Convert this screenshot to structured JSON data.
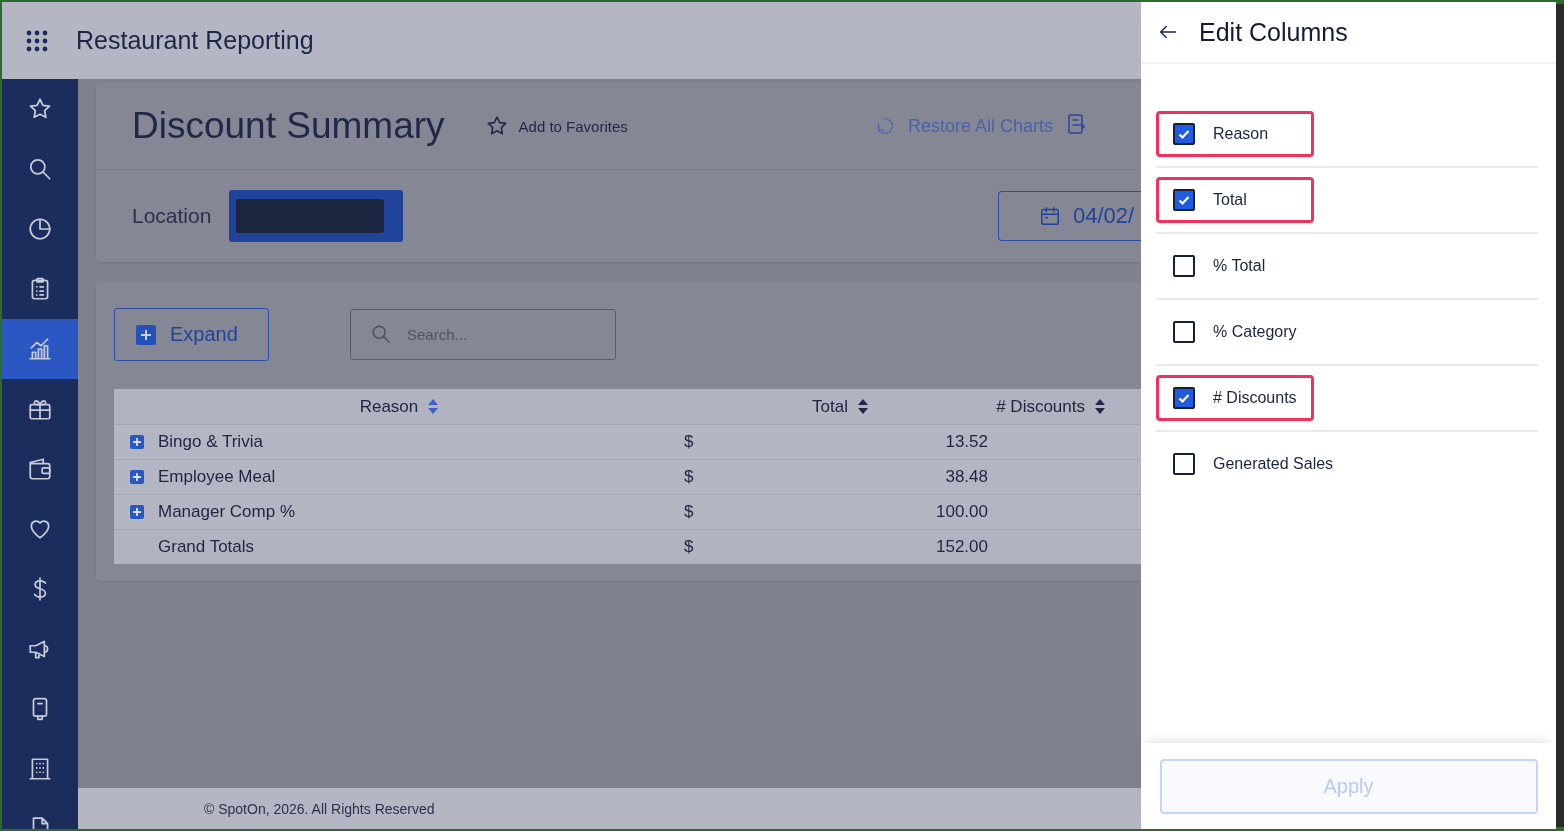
{
  "header": {
    "title": "Restaurant Reporting"
  },
  "sidebar": {
    "items": [
      {
        "selected": false
      },
      {
        "selected": false
      },
      {
        "selected": false
      },
      {
        "selected": false
      },
      {
        "selected": true
      },
      {
        "selected": false
      },
      {
        "selected": false
      },
      {
        "selected": false
      },
      {
        "selected": false
      },
      {
        "selected": false
      },
      {
        "selected": false
      },
      {
        "selected": false
      },
      {
        "selected": false
      }
    ]
  },
  "report": {
    "title": "Discount Summary",
    "favorite_label": "Add to Favorites",
    "restore_label": "Restore All Charts",
    "location_label": "Location",
    "date_value": "04/02/"
  },
  "toolbar": {
    "expand_label": "Expand",
    "search": {
      "placeholder": "Search..."
    }
  },
  "table": {
    "columns": [
      {
        "label": "Reason",
        "sort_active": true
      },
      {
        "label": "Total",
        "sort_active": false
      },
      {
        "label": "# Discounts",
        "sort_active": false
      }
    ],
    "rows": [
      {
        "kind": "item",
        "reason": "Bingo & Trivia",
        "currency": "$",
        "total": "13.52"
      },
      {
        "kind": "item",
        "reason": "Employee Meal",
        "currency": "$",
        "total": "38.48"
      },
      {
        "kind": "item",
        "reason": "Manager Comp %",
        "currency": "$",
        "total": "100.00"
      },
      {
        "kind": "total",
        "reason": "Grand Totals",
        "currency": "$",
        "total": "152.00"
      }
    ]
  },
  "footer": {
    "copyright": "© SpotOn, 2026. All Rights Reserved"
  },
  "panel": {
    "title": "Edit Columns",
    "columns": [
      {
        "label": "Reason",
        "checked": true,
        "highlighted": true
      },
      {
        "label": "Total",
        "checked": true,
        "highlighted": true
      },
      {
        "label": "% Total",
        "checked": false,
        "highlighted": false
      },
      {
        "label": "% Category",
        "checked": false,
        "highlighted": false
      },
      {
        "label": "# Discounts",
        "checked": true,
        "highlighted": true
      },
      {
        "label": "Generated Sales",
        "checked": false,
        "highlighted": false
      }
    ],
    "apply": {
      "label": "Apply",
      "disabled": true
    }
  }
}
